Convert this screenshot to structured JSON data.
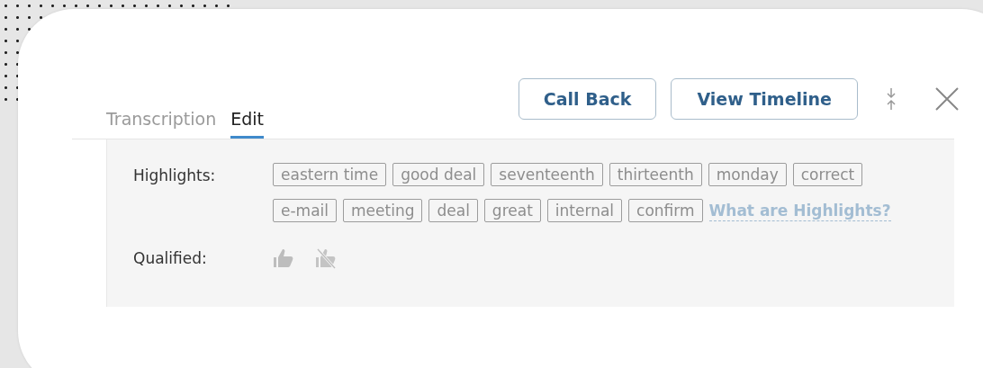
{
  "actions": [
    {
      "label": "Call Back"
    },
    {
      "label": "View Timeline"
    }
  ],
  "tabs": [
    {
      "label": "Transcription",
      "selected": false
    },
    {
      "label": "Edit",
      "selected": true
    }
  ],
  "highlights": {
    "label": "Highlights:",
    "tags": [
      "eastern time",
      "good deal",
      "seventeenth",
      "thirteenth",
      "monday",
      "correct",
      "e-mail",
      "meeting",
      "deal",
      "great",
      "internal",
      "confirm"
    ],
    "help_link": "What are Highlights?"
  },
  "qualified": {
    "label": "Qualified:"
  }
}
